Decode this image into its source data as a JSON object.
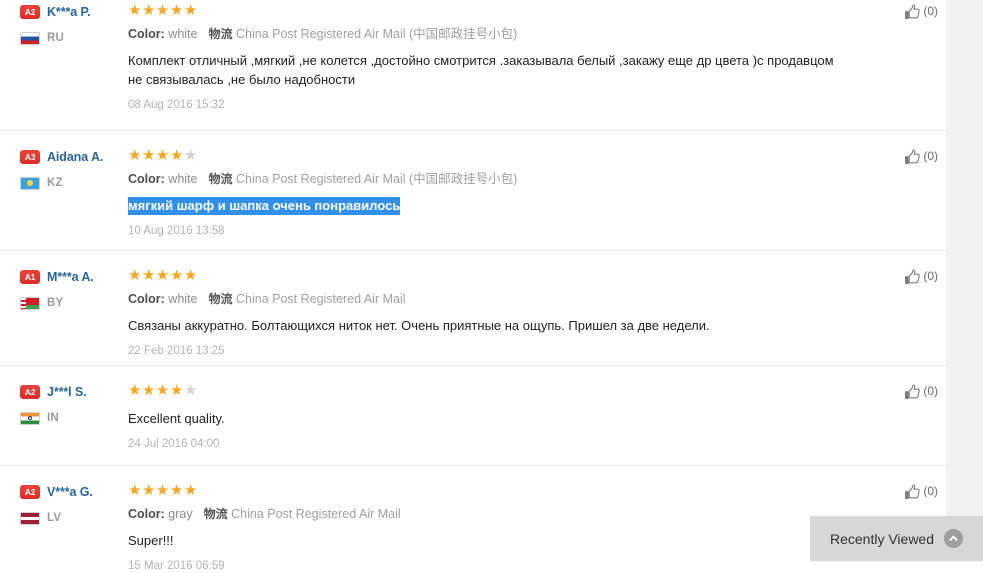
{
  "page": {
    "title": "Product reviews list"
  },
  "icons": {
    "thumb_up": "thumbs-up-icon",
    "chevron_up": "chevron-up-icon"
  },
  "colors": {
    "star_on": "#f6a623",
    "star_off": "#d2d2d2",
    "level_badge": "#e4393c",
    "author_link": "#2a6496",
    "selection_highlight": "#3390e8",
    "recently_viewed_bg": "#d7d7d7"
  },
  "labels": {
    "color_label": "Color:",
    "logistics_mark": "物流"
  },
  "reviews": [
    {
      "level": "A2",
      "name": "K***a P.",
      "country": "RU",
      "flag": "flag-RU",
      "rating": 5,
      "color_value": "white",
      "logistics": "China Post Registered Air Mail (中国邮政挂号小包)",
      "text": "Комплект отличный ,мягкий ,не колется ,достойно смотрится .заказывала белый ,закажу еще др цвета )с продавцом не связывалась ,не было надобности",
      "selected": false,
      "date": "08 Aug 2016 15:32",
      "helpful": "(0)"
    },
    {
      "level": "A3",
      "name": "Aidana A.",
      "country": "KZ",
      "flag": "flag-KZ",
      "rating": 4,
      "color_value": "white",
      "logistics": "China Post Registered Air Mail (中国邮政挂号小包)",
      "text": "мягкий шарф и шапка очень понравилось",
      "selected": true,
      "date": "10 Aug 2016 13:58",
      "helpful": "(0)"
    },
    {
      "level": "A1",
      "name": "M***a A.",
      "country": "BY",
      "flag": "flag-BY",
      "rating": 5,
      "color_value": "white",
      "logistics": "China Post Registered Air Mail",
      "text": "Связаны аккуратно. Болтающихся ниток нет. Очень приятные на ощупь. Пришел за две недели.",
      "selected": false,
      "date": "22 Feb 2016 13:25",
      "helpful": "(0)"
    },
    {
      "level": "A2",
      "name": "J***l S.",
      "country": "IN",
      "flag": "flag-IN",
      "rating": 4,
      "color_value": "",
      "logistics": "",
      "text": "Excellent quality.",
      "selected": false,
      "date": "24 Jul 2016 04:00",
      "helpful": "(0)"
    },
    {
      "level": "A2",
      "name": "V***a G.",
      "country": "LV",
      "flag": "flag-LV",
      "rating": 5,
      "color_value": "gray",
      "logistics": "China Post Registered Air Mail",
      "text": "Super!!!",
      "selected": false,
      "date": "15 Mar 2016 06:59",
      "helpful": "(0)"
    }
  ],
  "recently_viewed": {
    "label": "Recently Viewed"
  }
}
